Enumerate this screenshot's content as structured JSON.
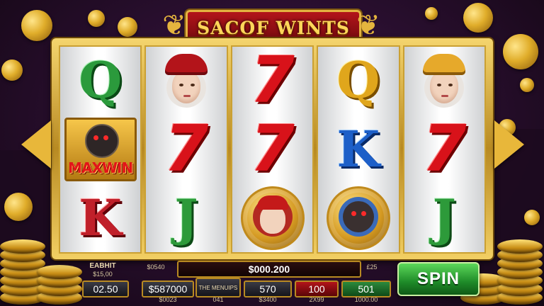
{
  "title": "SACOF WINTS",
  "reels": [
    [
      {
        "kind": "letter",
        "text": "Q",
        "style": "q-green"
      },
      {
        "kind": "maxwin",
        "text": "MAXWIN"
      },
      {
        "kind": "letter",
        "text": "K",
        "style": "k-red"
      }
    ],
    [
      {
        "kind": "portrait",
        "hat": "red"
      },
      {
        "kind": "seven",
        "text": "7"
      },
      {
        "kind": "letter",
        "text": "J",
        "style": "j-green"
      }
    ],
    [
      {
        "kind": "seven",
        "text": "7"
      },
      {
        "kind": "seven",
        "text": "7"
      },
      {
        "kind": "medal",
        "variant": "portrait"
      }
    ],
    [
      {
        "kind": "letter",
        "text": "Q",
        "style": "q-gold"
      },
      {
        "kind": "letter",
        "text": "K",
        "style": "k-blue"
      },
      {
        "kind": "medal",
        "variant": "beast"
      }
    ],
    [
      {
        "kind": "portrait",
        "hat": "gold"
      },
      {
        "kind": "seven",
        "text": "7"
      },
      {
        "kind": "letter",
        "text": "J",
        "style": "j-green"
      }
    ]
  ],
  "panel": {
    "credit_label": "EABHIT",
    "credit_sub": "$15,00",
    "credit_value": "02.50",
    "total_label": "$0540",
    "win_value": "$000.200",
    "right_label": "£25",
    "balance_value": "$587000",
    "balance_sub": "$0023",
    "meters_label": "THE MENUIPS",
    "meters_sub": "041",
    "box3_value": "570",
    "box3_sub": "$3400",
    "box4_value": "100",
    "box4_sub": "2X99",
    "box5_value": "501",
    "box5_sub": "1000.00",
    "spin_label": "SPIN"
  },
  "colors": {
    "frame_gold": "#e4b341",
    "title_red": "#b3141a",
    "spin_green": "#2c9a36",
    "background": "#2a0f30"
  }
}
